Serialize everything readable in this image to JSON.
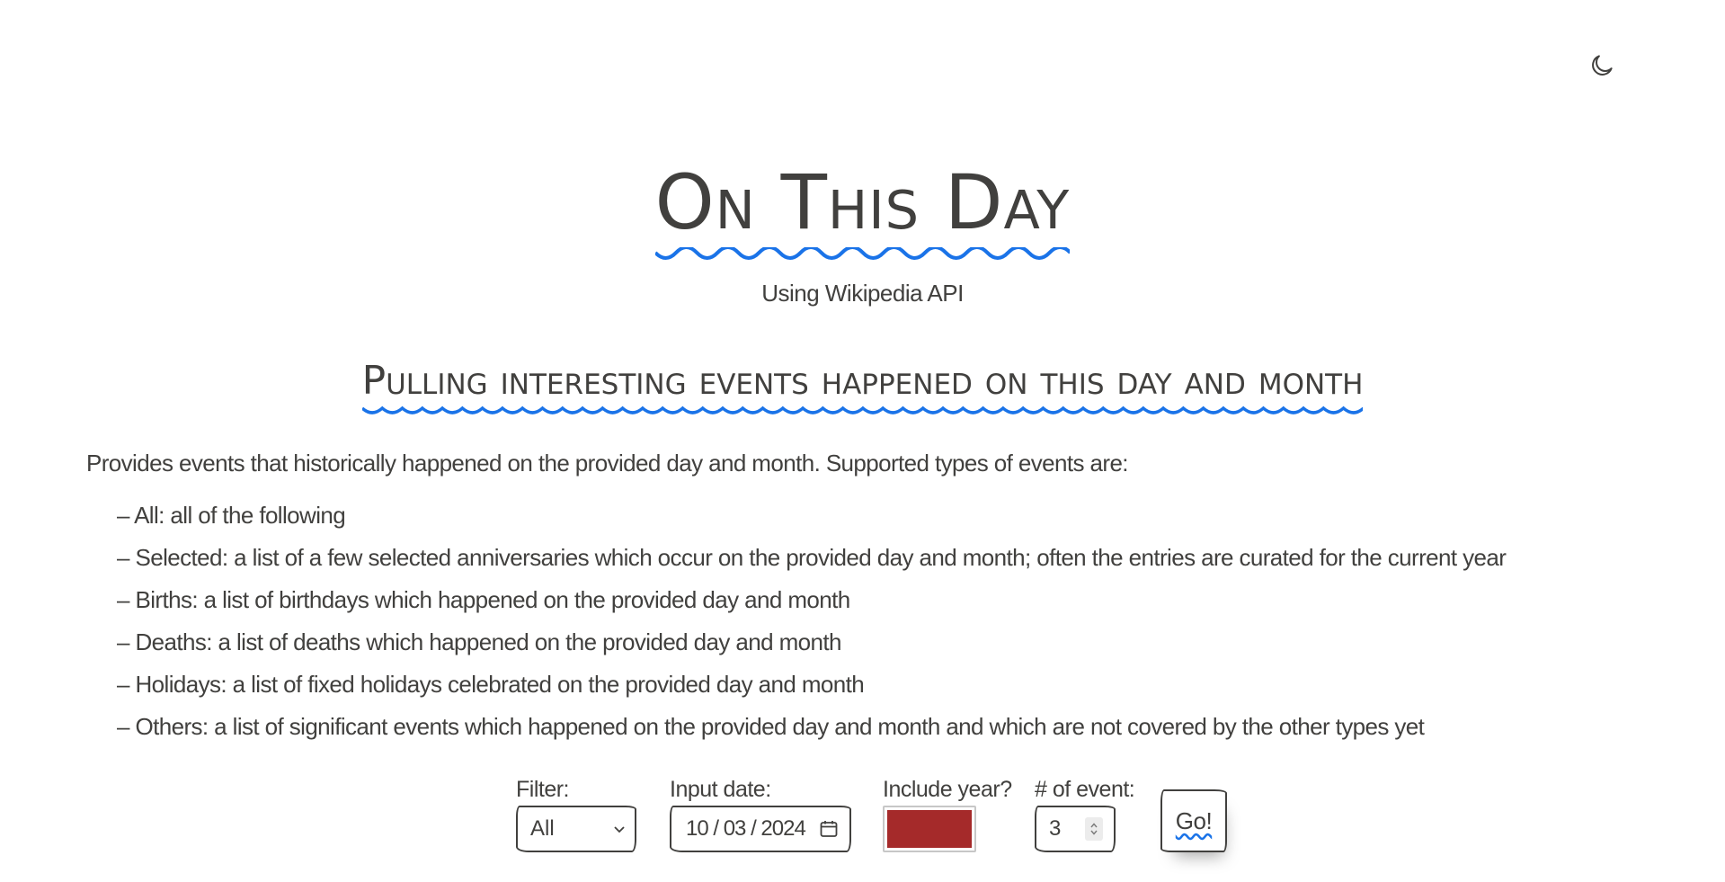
{
  "header": {
    "theme_toggle_icon": "moon-icon"
  },
  "hero": {
    "title": "On This Day",
    "subtitle": "Using Wikipedia API",
    "accent_color": "#1a73e8"
  },
  "section": {
    "heading": "Pulling interesting events happened on this day and month",
    "intro": "Provides events that historically happened on the provided day and month. Supported types of events are:",
    "types": [
      "All: all of the following",
      "Selected: a list of a few selected anniversaries which occur on the provided day and month; often the entries are curated for the current year",
      "Births: a list of birthdays which happened on the provided day and month",
      "Deaths: a list of deaths which happened on the provided day and month",
      "Holidays: a list of fixed holidays celebrated on the provided day and month",
      "Others: a list of significant events which happened on the provided day and month and which are not covered by the other types yet"
    ]
  },
  "form": {
    "filter_label": "Filter:",
    "filter_value": "All",
    "date_label": "Input date:",
    "date_value": "10 / 03 / 2024",
    "include_year_label": "Include year?",
    "include_year_color": "#a52a2a",
    "count_label": "# of event:",
    "count_value": "3",
    "go_label": "Go!"
  }
}
